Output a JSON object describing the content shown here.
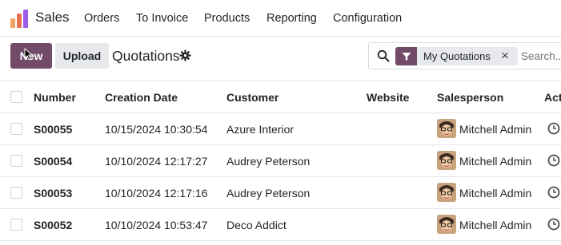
{
  "navbar": {
    "app_name": "Sales",
    "menu": [
      "Orders",
      "To Invoice",
      "Products",
      "Reporting",
      "Configuration"
    ]
  },
  "control_panel": {
    "new_label": "New",
    "upload_label": "Upload",
    "title": "Quotations"
  },
  "search": {
    "facet_label": "My Quotations",
    "remove_glyph": "×",
    "placeholder": "Search..."
  },
  "table": {
    "columns": [
      "Number",
      "Creation Date",
      "Customer",
      "Website",
      "Salesperson",
      "Act"
    ],
    "rows": [
      {
        "number": "S00055",
        "date": "10/15/2024 10:30:54",
        "customer": "Azure Interior",
        "website": "",
        "salesperson": "Mitchell Admin"
      },
      {
        "number": "S00054",
        "date": "10/10/2024 12:17:27",
        "customer": "Audrey Peterson",
        "website": "",
        "salesperson": "Mitchell Admin"
      },
      {
        "number": "S00053",
        "date": "10/10/2024 12:17:16",
        "customer": "Audrey Peterson",
        "website": "",
        "salesperson": "Mitchell Admin"
      },
      {
        "number": "S00052",
        "date": "10/10/2024 10:53:47",
        "customer": "Deco Addict",
        "website": "",
        "salesperson": "Mitchell Admin"
      }
    ]
  },
  "icons": {
    "app": "sales-logo-icon",
    "gear": "gear-icon",
    "search": "search-icon",
    "filter": "filter-icon",
    "activity": "clock-icon"
  },
  "colors": {
    "brand": "#714b67",
    "secondary_button": "#e7e9ed",
    "border": "#e5e5e5"
  }
}
